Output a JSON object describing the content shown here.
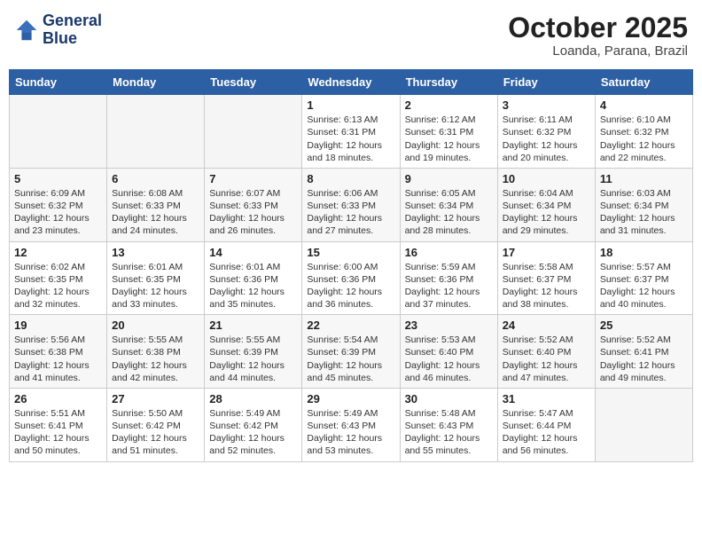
{
  "header": {
    "logo_line1": "General",
    "logo_line2": "Blue",
    "month": "October 2025",
    "location": "Loanda, Parana, Brazil"
  },
  "weekdays": [
    "Sunday",
    "Monday",
    "Tuesday",
    "Wednesday",
    "Thursday",
    "Friday",
    "Saturday"
  ],
  "weeks": [
    [
      {
        "day": "",
        "info": ""
      },
      {
        "day": "",
        "info": ""
      },
      {
        "day": "",
        "info": ""
      },
      {
        "day": "1",
        "info": "Sunrise: 6:13 AM\nSunset: 6:31 PM\nDaylight: 12 hours\nand 18 minutes."
      },
      {
        "day": "2",
        "info": "Sunrise: 6:12 AM\nSunset: 6:31 PM\nDaylight: 12 hours\nand 19 minutes."
      },
      {
        "day": "3",
        "info": "Sunrise: 6:11 AM\nSunset: 6:32 PM\nDaylight: 12 hours\nand 20 minutes."
      },
      {
        "day": "4",
        "info": "Sunrise: 6:10 AM\nSunset: 6:32 PM\nDaylight: 12 hours\nand 22 minutes."
      }
    ],
    [
      {
        "day": "5",
        "info": "Sunrise: 6:09 AM\nSunset: 6:32 PM\nDaylight: 12 hours\nand 23 minutes."
      },
      {
        "day": "6",
        "info": "Sunrise: 6:08 AM\nSunset: 6:33 PM\nDaylight: 12 hours\nand 24 minutes."
      },
      {
        "day": "7",
        "info": "Sunrise: 6:07 AM\nSunset: 6:33 PM\nDaylight: 12 hours\nand 26 minutes."
      },
      {
        "day": "8",
        "info": "Sunrise: 6:06 AM\nSunset: 6:33 PM\nDaylight: 12 hours\nand 27 minutes."
      },
      {
        "day": "9",
        "info": "Sunrise: 6:05 AM\nSunset: 6:34 PM\nDaylight: 12 hours\nand 28 minutes."
      },
      {
        "day": "10",
        "info": "Sunrise: 6:04 AM\nSunset: 6:34 PM\nDaylight: 12 hours\nand 29 minutes."
      },
      {
        "day": "11",
        "info": "Sunrise: 6:03 AM\nSunset: 6:34 PM\nDaylight: 12 hours\nand 31 minutes."
      }
    ],
    [
      {
        "day": "12",
        "info": "Sunrise: 6:02 AM\nSunset: 6:35 PM\nDaylight: 12 hours\nand 32 minutes."
      },
      {
        "day": "13",
        "info": "Sunrise: 6:01 AM\nSunset: 6:35 PM\nDaylight: 12 hours\nand 33 minutes."
      },
      {
        "day": "14",
        "info": "Sunrise: 6:01 AM\nSunset: 6:36 PM\nDaylight: 12 hours\nand 35 minutes."
      },
      {
        "day": "15",
        "info": "Sunrise: 6:00 AM\nSunset: 6:36 PM\nDaylight: 12 hours\nand 36 minutes."
      },
      {
        "day": "16",
        "info": "Sunrise: 5:59 AM\nSunset: 6:36 PM\nDaylight: 12 hours\nand 37 minutes."
      },
      {
        "day": "17",
        "info": "Sunrise: 5:58 AM\nSunset: 6:37 PM\nDaylight: 12 hours\nand 38 minutes."
      },
      {
        "day": "18",
        "info": "Sunrise: 5:57 AM\nSunset: 6:37 PM\nDaylight: 12 hours\nand 40 minutes."
      }
    ],
    [
      {
        "day": "19",
        "info": "Sunrise: 5:56 AM\nSunset: 6:38 PM\nDaylight: 12 hours\nand 41 minutes."
      },
      {
        "day": "20",
        "info": "Sunrise: 5:55 AM\nSunset: 6:38 PM\nDaylight: 12 hours\nand 42 minutes."
      },
      {
        "day": "21",
        "info": "Sunrise: 5:55 AM\nSunset: 6:39 PM\nDaylight: 12 hours\nand 44 minutes."
      },
      {
        "day": "22",
        "info": "Sunrise: 5:54 AM\nSunset: 6:39 PM\nDaylight: 12 hours\nand 45 minutes."
      },
      {
        "day": "23",
        "info": "Sunrise: 5:53 AM\nSunset: 6:40 PM\nDaylight: 12 hours\nand 46 minutes."
      },
      {
        "day": "24",
        "info": "Sunrise: 5:52 AM\nSunset: 6:40 PM\nDaylight: 12 hours\nand 47 minutes."
      },
      {
        "day": "25",
        "info": "Sunrise: 5:52 AM\nSunset: 6:41 PM\nDaylight: 12 hours\nand 49 minutes."
      }
    ],
    [
      {
        "day": "26",
        "info": "Sunrise: 5:51 AM\nSunset: 6:41 PM\nDaylight: 12 hours\nand 50 minutes."
      },
      {
        "day": "27",
        "info": "Sunrise: 5:50 AM\nSunset: 6:42 PM\nDaylight: 12 hours\nand 51 minutes."
      },
      {
        "day": "28",
        "info": "Sunrise: 5:49 AM\nSunset: 6:42 PM\nDaylight: 12 hours\nand 52 minutes."
      },
      {
        "day": "29",
        "info": "Sunrise: 5:49 AM\nSunset: 6:43 PM\nDaylight: 12 hours\nand 53 minutes."
      },
      {
        "day": "30",
        "info": "Sunrise: 5:48 AM\nSunset: 6:43 PM\nDaylight: 12 hours\nand 55 minutes."
      },
      {
        "day": "31",
        "info": "Sunrise: 5:47 AM\nSunset: 6:44 PM\nDaylight: 12 hours\nand 56 minutes."
      },
      {
        "day": "",
        "info": ""
      }
    ]
  ]
}
